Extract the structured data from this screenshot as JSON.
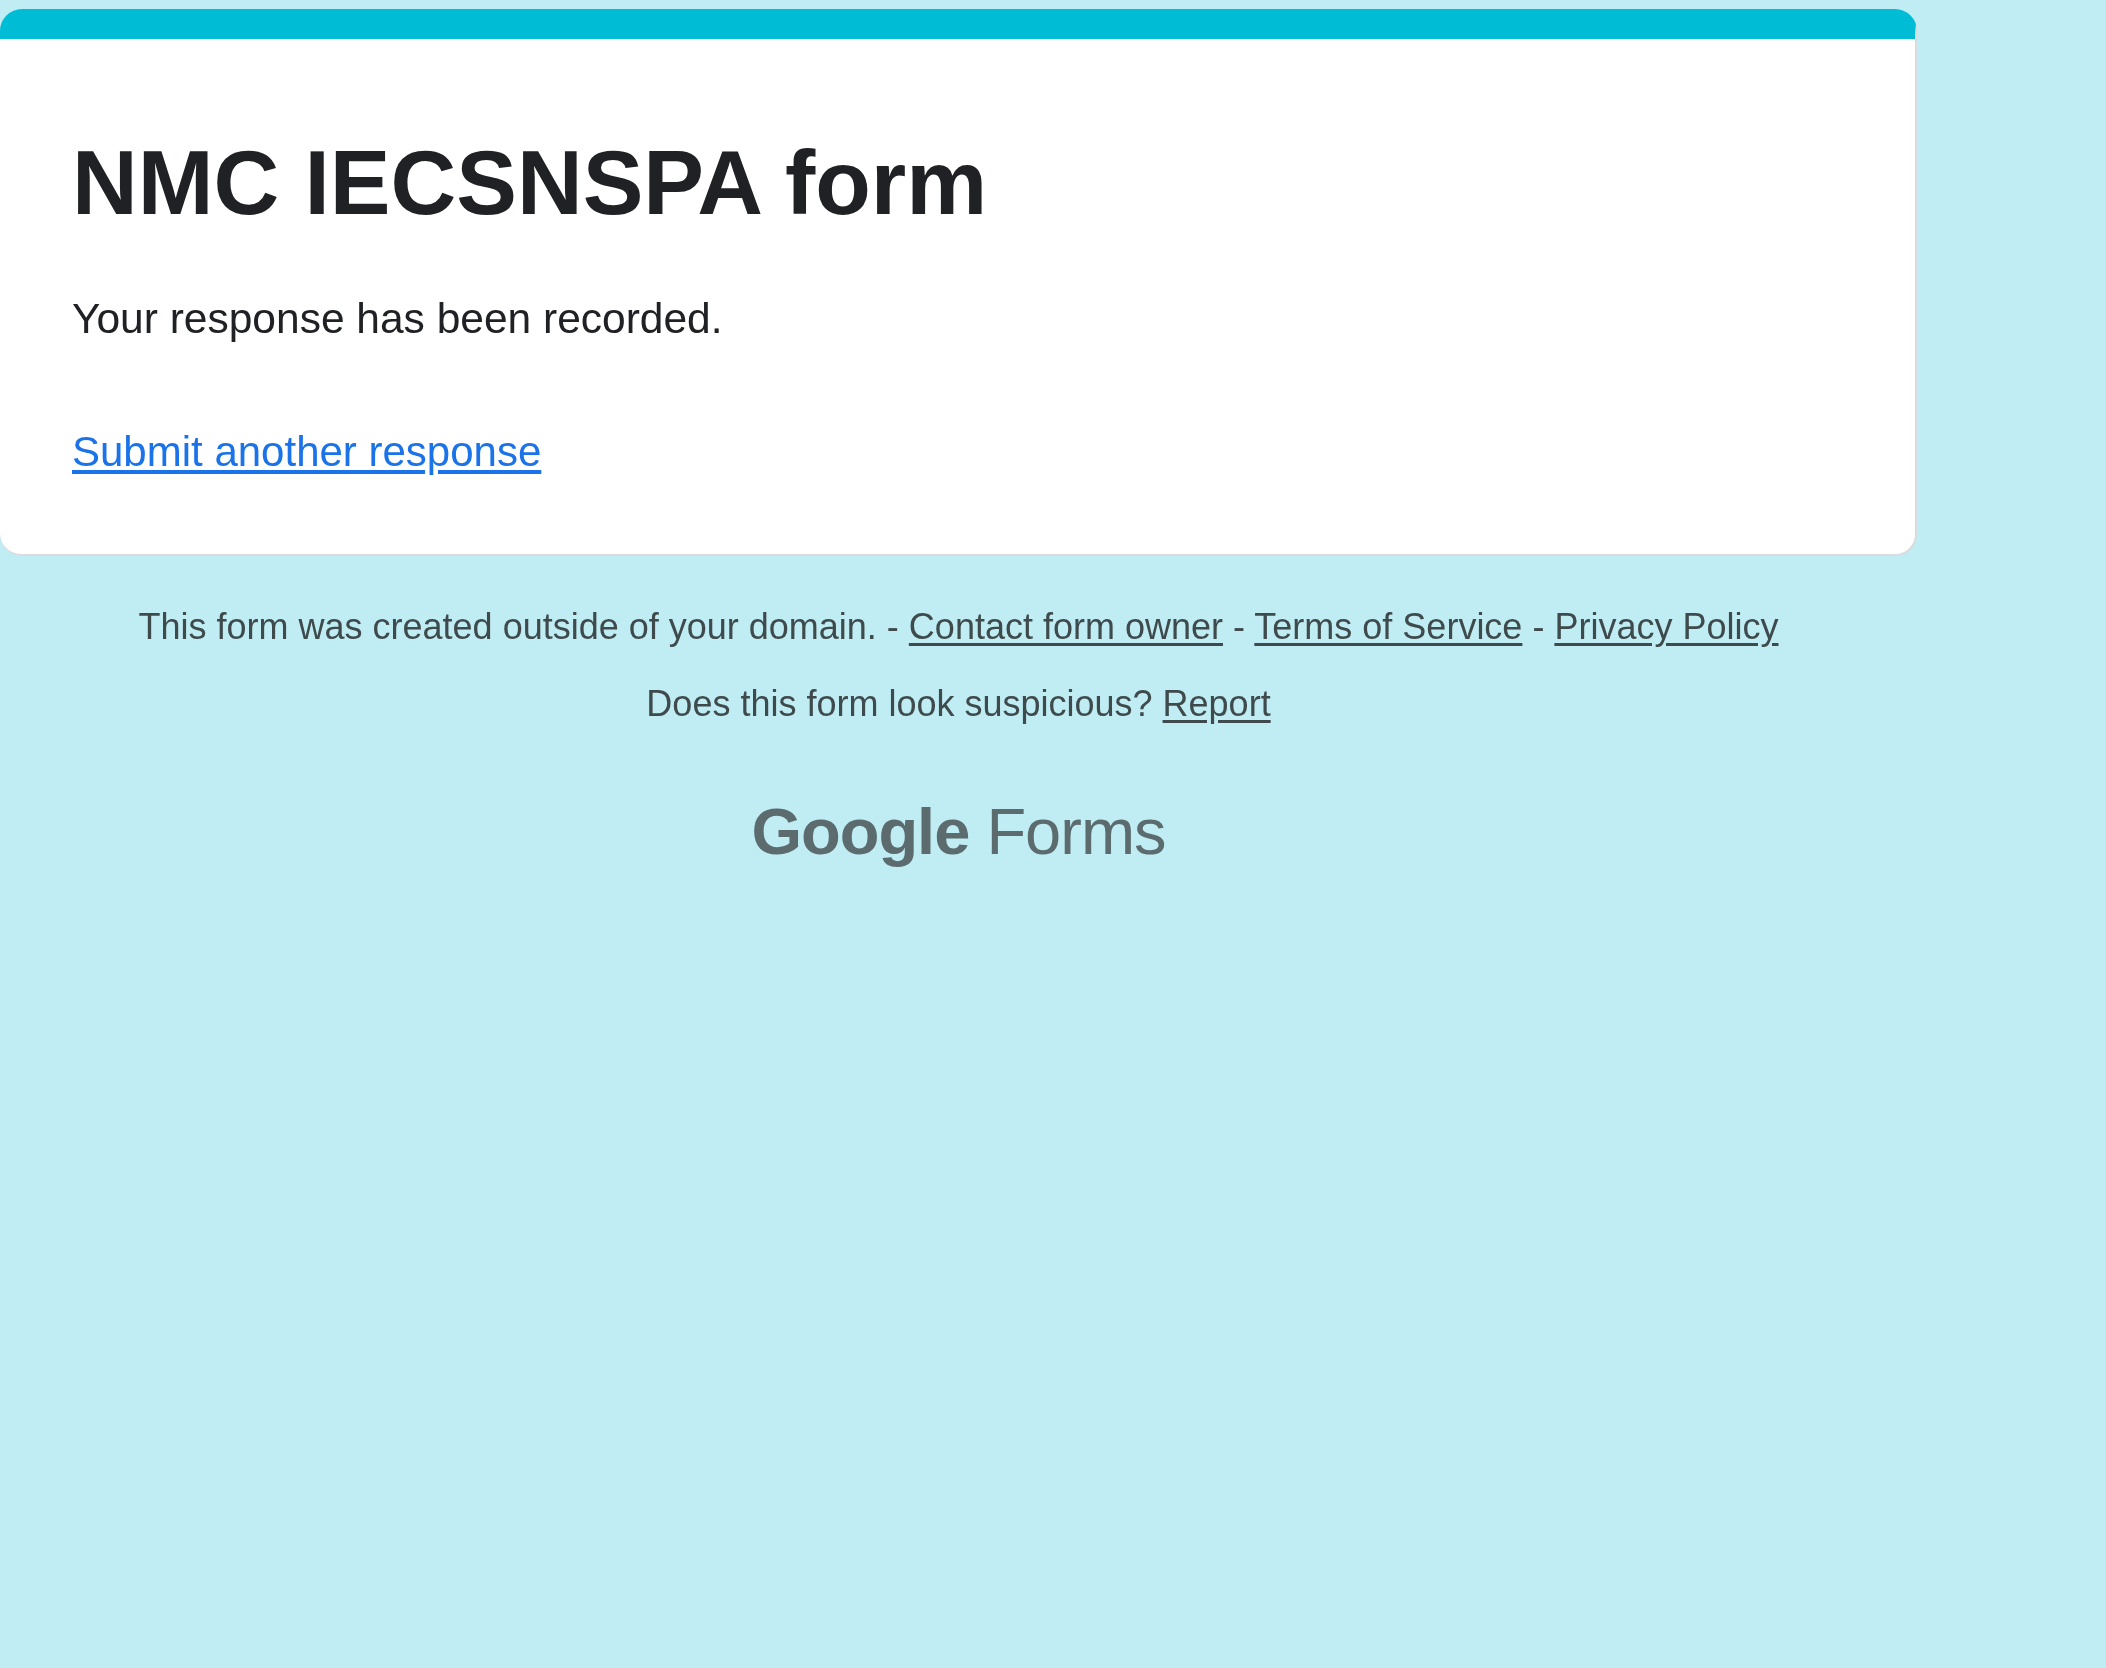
{
  "form": {
    "title": "NMC IECSNSPA form",
    "confirmation": "Your response has been recorded.",
    "submit_another_link": "Submit another response"
  },
  "footer": {
    "lines": [
      {
        "parts": [
          {
            "kind": "text",
            "text": "This form was created outside of your domain. - "
          },
          {
            "kind": "link",
            "text": "Contact form owner"
          },
          {
            "kind": "text",
            "text": " - "
          },
          {
            "kind": "link",
            "text": "Terms of Service"
          },
          {
            "kind": "text",
            "text": " - "
          },
          {
            "kind": "link",
            "text": "Privacy Policy"
          }
        ]
      },
      {
        "parts": [
          {
            "kind": "text",
            "text": "Does this form look suspicious? "
          },
          {
            "kind": "link",
            "text": "Report"
          }
        ]
      }
    ],
    "logo": "**Google** Forms"
  }
}
